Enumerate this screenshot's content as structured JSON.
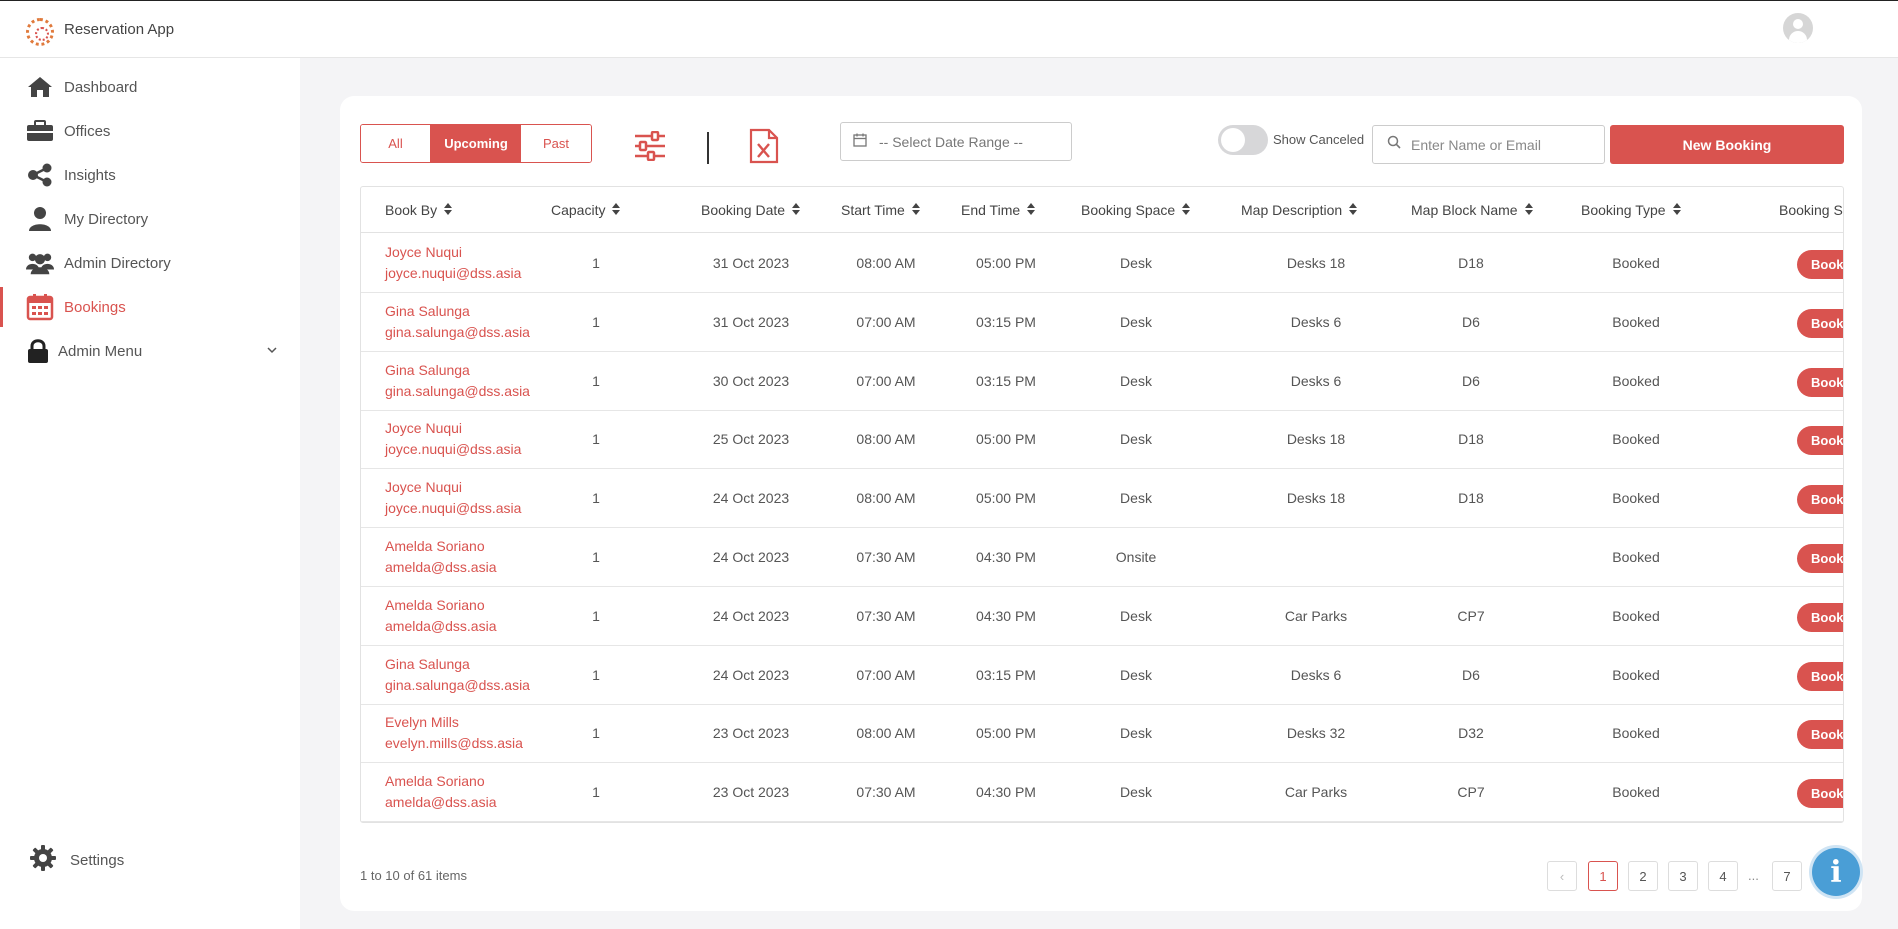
{
  "app": {
    "title": "Reservation App"
  },
  "sidebar": {
    "items": [
      {
        "label": "Dashboard",
        "icon": "home-icon"
      },
      {
        "label": "Offices",
        "icon": "briefcase-icon"
      },
      {
        "label": "Insights",
        "icon": "share-icon"
      },
      {
        "label": "My Directory",
        "icon": "user-icon"
      },
      {
        "label": "Admin Directory",
        "icon": "users-icon"
      },
      {
        "label": "Bookings",
        "icon": "calendar-icon",
        "active": true
      },
      {
        "label": "Admin Menu",
        "icon": "lock-icon",
        "has_children": true
      }
    ],
    "settings_label": "Settings"
  },
  "toolbar": {
    "filter_tabs": [
      "All",
      "Upcoming",
      "Past"
    ],
    "active_tab": "Upcoming",
    "date_placeholder": "-- Select Date Range --",
    "show_canceled_label": "Show Canceled",
    "show_canceled": false,
    "search_placeholder": "Enter Name or Email",
    "new_booking_label": "New Booking"
  },
  "table": {
    "columns": [
      "Book By",
      "Capacity",
      "Booking Date",
      "Start Time",
      "End Time",
      "Booking Space",
      "Map Description",
      "Map Block Name",
      "Booking Type",
      "Booking S"
    ],
    "rows": [
      {
        "name": "Joyce Nuqui",
        "email": "joyce.nuqui@dss.asia",
        "capacity": "1",
        "date": "31 Oct 2023",
        "start": "08:00 AM",
        "end": "05:00 PM",
        "space": "Desk",
        "desc": "Desks 18",
        "block": "D18",
        "type": "Booked",
        "status": "Booke"
      },
      {
        "name": "Gina Salunga",
        "email": "gina.salunga@dss.asia",
        "capacity": "1",
        "date": "31 Oct 2023",
        "start": "07:00 AM",
        "end": "03:15 PM",
        "space": "Desk",
        "desc": "Desks 6",
        "block": "D6",
        "type": "Booked",
        "status": "Booke"
      },
      {
        "name": "Gina Salunga",
        "email": "gina.salunga@dss.asia",
        "capacity": "1",
        "date": "30 Oct 2023",
        "start": "07:00 AM",
        "end": "03:15 PM",
        "space": "Desk",
        "desc": "Desks 6",
        "block": "D6",
        "type": "Booked",
        "status": "Booke"
      },
      {
        "name": "Joyce Nuqui",
        "email": "joyce.nuqui@dss.asia",
        "capacity": "1",
        "date": "25 Oct 2023",
        "start": "08:00 AM",
        "end": "05:00 PM",
        "space": "Desk",
        "desc": "Desks 18",
        "block": "D18",
        "type": "Booked",
        "status": "Booke"
      },
      {
        "name": "Joyce Nuqui",
        "email": "joyce.nuqui@dss.asia",
        "capacity": "1",
        "date": "24 Oct 2023",
        "start": "08:00 AM",
        "end": "05:00 PM",
        "space": "Desk",
        "desc": "Desks 18",
        "block": "D18",
        "type": "Booked",
        "status": "Booke"
      },
      {
        "name": "Amelda Soriano",
        "email": "amelda@dss.asia",
        "capacity": "1",
        "date": "24 Oct 2023",
        "start": "07:30 AM",
        "end": "04:30 PM",
        "space": "Onsite",
        "desc": "",
        "block": "",
        "type": "Booked",
        "status": "Booke"
      },
      {
        "name": "Amelda Soriano",
        "email": "amelda@dss.asia",
        "capacity": "1",
        "date": "24 Oct 2023",
        "start": "07:30 AM",
        "end": "04:30 PM",
        "space": "Desk",
        "desc": "Car Parks",
        "block": "CP7",
        "type": "Booked",
        "status": "Booke"
      },
      {
        "name": "Gina Salunga",
        "email": "gina.salunga@dss.asia",
        "capacity": "1",
        "date": "24 Oct 2023",
        "start": "07:00 AM",
        "end": "03:15 PM",
        "space": "Desk",
        "desc": "Desks 6",
        "block": "D6",
        "type": "Booked",
        "status": "Booke"
      },
      {
        "name": "Evelyn Mills",
        "email": "evelyn.mills@dss.asia",
        "capacity": "1",
        "date": "23 Oct 2023",
        "start": "08:00 AM",
        "end": "05:00 PM",
        "space": "Desk",
        "desc": "Desks 32",
        "block": "D32",
        "type": "Booked",
        "status": "Booke"
      },
      {
        "name": "Amelda Soriano",
        "email": "amelda@dss.asia",
        "capacity": "1",
        "date": "23 Oct 2023",
        "start": "07:30 AM",
        "end": "04:30 PM",
        "space": "Desk",
        "desc": "Car Parks",
        "block": "CP7",
        "type": "Booked",
        "status": "Booke"
      }
    ]
  },
  "pagination": {
    "summary": "1 to 10 of 61 items",
    "prev": "‹",
    "pages": [
      "1",
      "2",
      "3",
      "4",
      "7"
    ],
    "ellipsis": "...",
    "current": "1"
  },
  "info_button": {
    "glyph": "i"
  },
  "colors": {
    "accent": "#d9534f",
    "info": "#4a9ed6"
  }
}
